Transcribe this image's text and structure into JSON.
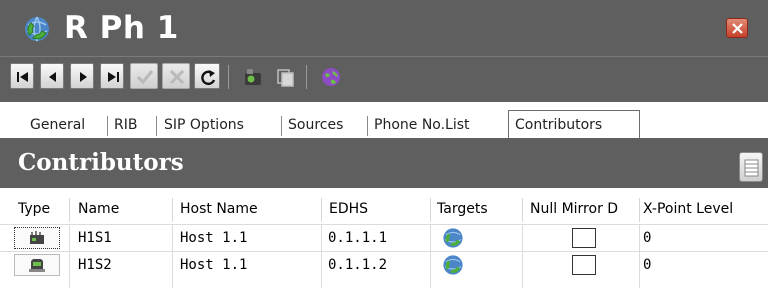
{
  "window": {
    "title": "R Ph 1",
    "app_icon": "phone-globe-icon",
    "close_icon": "close-icon"
  },
  "toolbar": {
    "buttons": [
      {
        "icon": "first-record-icon",
        "enabled": true
      },
      {
        "icon": "previous-record-icon",
        "enabled": true
      },
      {
        "icon": "next-record-icon",
        "enabled": true
      },
      {
        "icon": "last-record-icon",
        "enabled": true
      },
      {
        "icon": "accept-icon",
        "enabled": false
      },
      {
        "icon": "cancel-icon",
        "enabled": false
      },
      {
        "icon": "refresh-icon",
        "enabled": true
      },
      {
        "icon": "network-device-icon",
        "enabled": true
      },
      {
        "icon": "copy-icon",
        "enabled": false
      },
      {
        "icon": "globe-icon",
        "enabled": true
      }
    ]
  },
  "tabs": {
    "general": "General",
    "rib": "RIB",
    "sip_options": "SIP Options",
    "sources": "Sources",
    "phone_no_list": "Phone No.List",
    "contributors": "Contributors",
    "active": "Contributors"
  },
  "section": {
    "title": "Contributors",
    "menu_icon": "column-menu-icon"
  },
  "grid": {
    "columns": {
      "type": "Type",
      "name": "Name",
      "host_name": "Host Name",
      "edhs": "EDHS",
      "targets": "Targets",
      "null_mirror": "Null Mirror D",
      "xpoint_level": "X-Point Level"
    },
    "rows": [
      {
        "type_icon": "router-icon",
        "name": "H1S1",
        "host_name": "Host 1.1",
        "edhs": "0.1.1.1",
        "targets_icon": "phone-globe-icon",
        "null_mirror": false,
        "xpoint_level": "0"
      },
      {
        "type_icon": "device-icon",
        "name": "H1S2",
        "host_name": "Host 1.1",
        "edhs": "0.1.1.2",
        "targets_icon": "phone-globe-icon",
        "null_mirror": false,
        "xpoint_level": "0"
      }
    ]
  },
  "colors": {
    "header_bg": "#5f5f5f",
    "close_red": "#c6412b",
    "icon_blue": "#4a86c8",
    "icon_green": "#4caf3b"
  }
}
